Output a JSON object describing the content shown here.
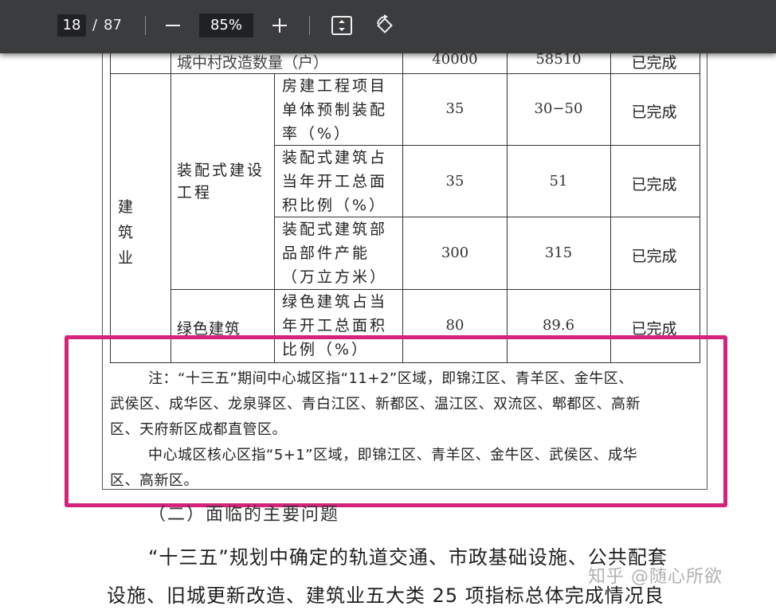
{
  "toolbar": {
    "current_page": "18",
    "separator": "/",
    "total_pages": "87",
    "zoom": "85%",
    "icons": [
      "zoom-out-icon",
      "zoom-in-icon",
      "fit-page-icon",
      "rotate-icon"
    ]
  },
  "table": {
    "top_row": {
      "item": "城中村改造数量（户）",
      "target": "40000",
      "actual": "58510",
      "status": "已完成"
    },
    "category": "建　筑　业",
    "groups": [
      {
        "name": "装配式建设工程",
        "rows": [
          {
            "item": "房建工程项目单体预制装配率（%）",
            "target": "35",
            "actual": "30−50",
            "status": "已完成"
          },
          {
            "item": "装配式建筑占当年开工总面积比例（%）",
            "target": "35",
            "actual": "51",
            "status": "已完成"
          },
          {
            "item": "装配式建筑部品部件产能（万立方米）",
            "target": "300",
            "actual": "315",
            "status": "已完成"
          }
        ]
      },
      {
        "name": "绿色建筑",
        "rows": [
          {
            "item": "绿色建筑占当年开工总面积比例（%）",
            "target": "80",
            "actual": "89.6",
            "status": "已完成"
          }
        ]
      }
    ]
  },
  "notes": {
    "note1_line1": "注：“十三五”期间中心城区指“11+2”区域，即锦江区、青羊区、金牛区、",
    "note1_line2": "武侯区、成华区、龙泉驿区、青白江区、新都区、温江区、双流区、郫都区、高新",
    "note1_line3": "区、天府新区成都直管区。",
    "note2_line1": "中心城区核心区指“5+1”区域，即锦江区、青羊区、金牛区、武侯区、成华",
    "note2_line2": "区、高新区。"
  },
  "section_heading": "（二）面临的主要问题",
  "body_text": {
    "line1": "“十三五”规划中确定的轨道交通、市政基础设施、公共配套",
    "line2": "设施、旧城更新改造、建筑业五大类 25 项指标总体完成情况良"
  },
  "watermark": "知乎 @随心所欲",
  "colors": {
    "toolbar_bg": "#3b3c3e",
    "highlight": "#d4237a"
  }
}
